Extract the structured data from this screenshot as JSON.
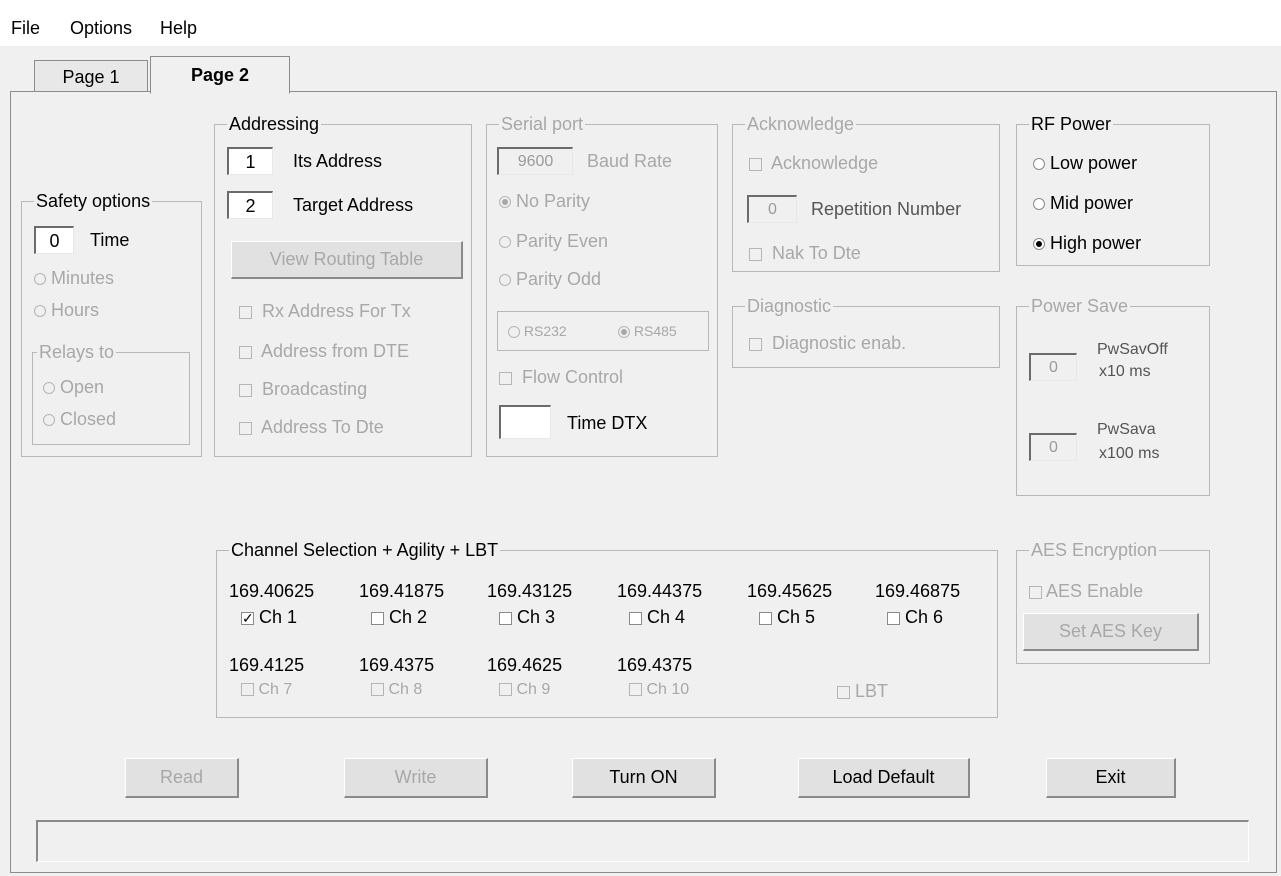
{
  "menu": {
    "file": "File",
    "options": "Options",
    "help": "Help"
  },
  "tabs": [
    "Page 1",
    "Page 2"
  ],
  "safety": {
    "title": "Safety options",
    "time_value": "0",
    "time_label": "Time",
    "minutes": "Minutes",
    "hours": "Hours",
    "relays_title": "Relays to",
    "open": "Open",
    "closed": "Closed"
  },
  "addressing": {
    "title": "Addressing",
    "its_value": "1",
    "its_label": "Its Address",
    "target_value": "2",
    "target_label": "Target Address",
    "routing_button": "View Routing Table",
    "rx_address": "Rx Address For Tx",
    "address_from_dte": "Address from DTE",
    "broadcasting": "Broadcasting",
    "address_to_dte": "Address To Dte"
  },
  "serial": {
    "title": "Serial port",
    "baud_value": "9600",
    "baud_label": "Baud Rate",
    "no_parity": "No Parity",
    "parity_even": "Parity Even",
    "parity_odd": "Parity Odd",
    "rs232": "RS232",
    "rs485": "RS485",
    "flow_control": "Flow Control",
    "time_dtx_label": "Time DTX"
  },
  "acknowledge": {
    "title": "Acknowledge",
    "ack_label": "Acknowledge",
    "rep_value": "0",
    "rep_label": "Repetition Number",
    "nak_label": "Nak To Dte"
  },
  "diagnostic": {
    "title": "Diagnostic",
    "enable_label": "Diagnostic enab."
  },
  "rf_power": {
    "title": "RF Power",
    "low": "Low power",
    "mid": "Mid power",
    "high": "High power"
  },
  "power_save": {
    "title": "Power Save",
    "off_value": "0",
    "off_label_1": "PwSavOff",
    "off_label_2": "x10 ms",
    "on_value": "0",
    "on_label_1": "PwSava",
    "on_label_2": "x100 ms"
  },
  "channels": {
    "title": "Channel Selection + Agility + LBT",
    "row1": [
      {
        "freq": "169.40625",
        "label": "Ch 1",
        "checked": true
      },
      {
        "freq": "169.41875",
        "label": "Ch 2",
        "checked": false
      },
      {
        "freq": "169.43125",
        "label": "Ch 3",
        "checked": false
      },
      {
        "freq": "169.44375",
        "label": "Ch 4",
        "checked": false
      },
      {
        "freq": "169.45625",
        "label": "Ch 5",
        "checked": false
      },
      {
        "freq": "169.46875",
        "label": "Ch 6",
        "checked": false
      }
    ],
    "row2": [
      {
        "freq": "169.4125",
        "label": "Ch 7"
      },
      {
        "freq": "169.4375",
        "label": "Ch 8"
      },
      {
        "freq": "169.4625",
        "label": "Ch 9"
      },
      {
        "freq": "169.4375",
        "label": "Ch 10"
      }
    ],
    "lbt_label": "LBT"
  },
  "aes": {
    "title": "AES Encryption",
    "enable_label": "AES Enable",
    "key_button": "Set AES Key"
  },
  "buttons": {
    "read": "Read",
    "write": "Write",
    "turn_on": "Turn ON",
    "load_default": "Load Default",
    "exit": "Exit"
  }
}
